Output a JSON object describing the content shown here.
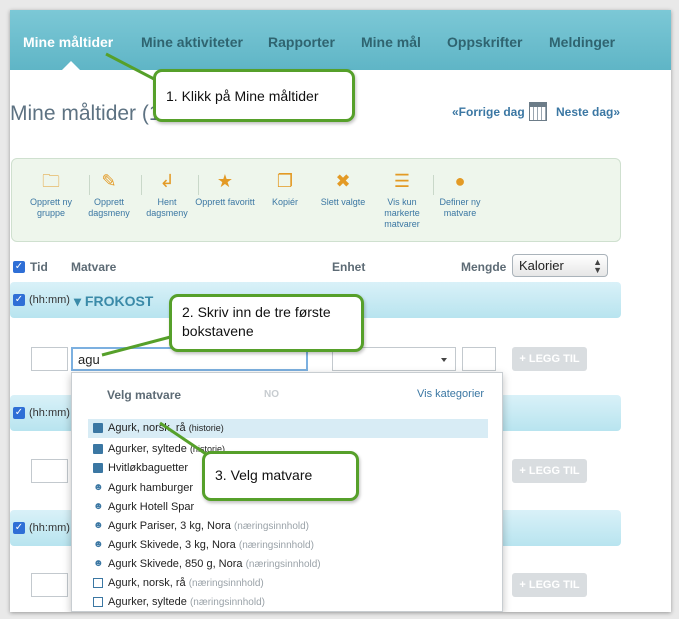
{
  "nav": {
    "items": [
      {
        "label": "Mine måltider",
        "active": true
      },
      {
        "label": "Mine aktiviteter",
        "active": false
      },
      {
        "label": "Rapporter",
        "active": false
      },
      {
        "label": "Mine mål",
        "active": false
      },
      {
        "label": "Oppskrifter",
        "active": false
      },
      {
        "label": "Meldinger",
        "active": false
      }
    ]
  },
  "header": {
    "title": "Mine måltider (1",
    "prev_day": "«Forrige dag",
    "next_day": "Neste dag»"
  },
  "toolbar": {
    "buttons": [
      {
        "icon": "folder-add-icon",
        "label": "Opprett ny gruppe"
      },
      {
        "icon": "edit-icon",
        "label": "Opprett dagsmeny"
      },
      {
        "icon": "import-icon",
        "label": "Hent dagsmeny"
      },
      {
        "icon": "star-add-icon",
        "label": "Opprett favoritt"
      },
      {
        "icon": "copy-icon",
        "label": "Kopiér"
      },
      {
        "icon": "delete-icon",
        "label": "Slett valgte"
      },
      {
        "icon": "list-icon",
        "label": "Vis kun markerte matvarer"
      },
      {
        "icon": "apple-icon",
        "label": "Definer ny matvare"
      }
    ]
  },
  "columns": {
    "time": "Tid",
    "food": "Matvare",
    "unit": "Enhet",
    "amount": "Mengde",
    "measure_selected": "Kalorier"
  },
  "meals": [
    {
      "time": "(hh:mm)",
      "name": "FROKOST"
    },
    {
      "time": "(hh:mm)",
      "name": ""
    },
    {
      "time": "(hh:mm)",
      "name": ""
    }
  ],
  "entry": {
    "search_value": "agu",
    "add_label": "+ LEGG TIL"
  },
  "dropdown": {
    "header": "Velg matvare",
    "lang": "NO",
    "categories_link": "Vis kategorier",
    "items": [
      {
        "icon": "book-icon",
        "name": "Agurk, norsk, rå",
        "note": "(historie)",
        "note_type": "hist",
        "highlighted": true
      },
      {
        "icon": "book-icon",
        "name": "Agurker, syltede",
        "note": "(historie)",
        "note_type": "hist",
        "highlighted": false
      },
      {
        "icon": "book-icon",
        "name": "Hvitløkbaguetter",
        "note": "",
        "note_type": "",
        "highlighted": false
      },
      {
        "icon": "user-icon",
        "name": "Agurk hamburger",
        "note": "",
        "note_type": "",
        "highlighted": false
      },
      {
        "icon": "user-icon",
        "name": "Agurk Hotell Spar",
        "note": "",
        "note_type": "",
        "highlighted": false
      },
      {
        "icon": "user-icon",
        "name": "Agurk Pariser, 3 kg, Nora",
        "note": "(næringsinnhold)",
        "note_type": "nut",
        "highlighted": false
      },
      {
        "icon": "user-icon",
        "name": "Agurk Skivede, 3 kg, Nora",
        "note": "(næringsinnhold)",
        "note_type": "nut",
        "highlighted": false
      },
      {
        "icon": "user-icon",
        "name": "Agurk Skivede, 850 g, Nora",
        "note": "(næringsinnhold)",
        "note_type": "nut",
        "highlighted": false
      },
      {
        "icon": "document-icon",
        "name": "Agurk, norsk, rå",
        "note": "(næringsinnhold)",
        "note_type": "nut",
        "highlighted": false
      },
      {
        "icon": "document-icon",
        "name": "Agurker, syltede",
        "note": "(næringsinnhold)",
        "note_type": "nut",
        "highlighted": false
      }
    ]
  },
  "callouts": {
    "step1": "1. Klikk på Mine  måltider",
    "step2": "2. Skriv inn de tre første bokstavene",
    "step3": "3. Velg matvare"
  },
  "colors": {
    "nav_bg": "#6ec0cf",
    "accent_green": "#56a02a",
    "link_blue": "#3b77a3",
    "meal_bar": "#c8eaf3"
  }
}
